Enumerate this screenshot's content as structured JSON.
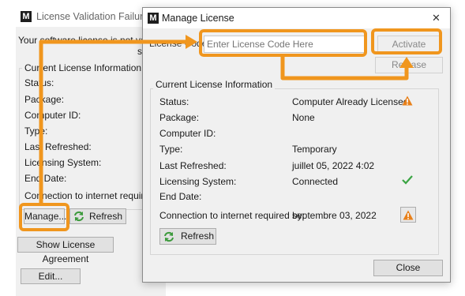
{
  "bg_window": {
    "title": "License Validation Failure",
    "message_line1": "Your software license is not valid. P",
    "message_line2": "suppor",
    "group_title": "Current License Information",
    "labels": [
      "Status:",
      "Package:",
      "Computer ID:",
      "Type:",
      "Last Refreshed:",
      "Licensing System:",
      "End Date:"
    ],
    "connection_label": "Connection to internet required",
    "manage_label": "Manage...",
    "refresh_label": "Refresh",
    "agreement_label": "Show License Agreement",
    "edit_label": "Edit..."
  },
  "dialog": {
    "title": "Manage License",
    "close_glyph": "✕",
    "license_code_label": "License Code",
    "license_code_value": "",
    "license_code_placeholder": "Enter License Code Here",
    "activate_label": "Activate",
    "release_label": "Release",
    "group_title": "Current License Information",
    "fields": [
      {
        "label": "Status:",
        "value": "Computer Already Licensed"
      },
      {
        "label": "Package:",
        "value": "None"
      },
      {
        "label": "Computer ID:",
        "value": ""
      },
      {
        "label": "Type:",
        "value": "Temporary"
      },
      {
        "label": "Last Refreshed:",
        "value": "juillet 05, 2022 4:02"
      },
      {
        "label": "Licensing System:",
        "value": "Connected"
      },
      {
        "label": "End Date:",
        "value": ""
      },
      {
        "label": "Connection to internet required by:",
        "value": "septembre 03, 2022"
      }
    ],
    "refresh_label": "Refresh",
    "close_label": "Close"
  },
  "icons": {
    "app_logo": "M",
    "warning_icon": "warning-triangle-icon",
    "check_icon": "check-icon",
    "refresh_icon": "refresh-icon",
    "warning_button_icon": "warning-button-icon"
  },
  "colors": {
    "highlight": "#f0961e",
    "warning": "#e8801a",
    "success": "#3ba544",
    "refresh_green": "#3c9a3c"
  }
}
